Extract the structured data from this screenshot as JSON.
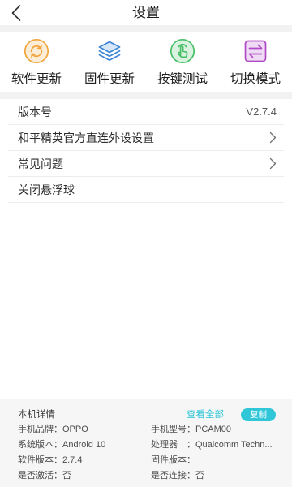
{
  "header": {
    "back_icon": "chevron-left-icon",
    "title": "设置"
  },
  "quick_actions": [
    {
      "label": "软件更新",
      "icon": "refresh-icon",
      "color": "#f0a43a"
    },
    {
      "label": "固件更新",
      "icon": "layers-icon",
      "color": "#3d86d6"
    },
    {
      "label": "按键测试",
      "icon": "finger-tap-icon",
      "color": "#46bf66"
    },
    {
      "label": "切换模式",
      "icon": "swap-arrows-icon",
      "color": "#b04ac6"
    }
  ],
  "settings_list": [
    {
      "label": "版本号",
      "value": "V2.7.4"
    },
    {
      "label": "和平精英官方直连外设设置",
      "icon": "chevron-right-icon"
    },
    {
      "label": "常见问题",
      "icon": "chevron-right-icon"
    },
    {
      "label": "关闭悬浮球"
    }
  ],
  "device_info": {
    "title": "本机详情",
    "view_all": "查看全部",
    "copy": "复制",
    "accent_color": "#2fc6d8",
    "rows": [
      {
        "left": {
          "label": "手机品牌：",
          "value": "OPPO"
        },
        "right": {
          "label": "手机型号：",
          "value": "PCAM00"
        }
      },
      {
        "left": {
          "label": "系统版本：",
          "value": "Android 10"
        },
        "right": {
          "label": "处理器　：",
          "value": "Qualcomm Techn..."
        }
      },
      {
        "left": {
          "label": "软件版本：",
          "value": "2.7.4"
        },
        "right": {
          "label": "固件版本："
        }
      },
      {
        "left": {
          "label": "是否激活：",
          "value": "否"
        },
        "right": {
          "label": "是否连接：",
          "value": "否"
        }
      }
    ]
  }
}
